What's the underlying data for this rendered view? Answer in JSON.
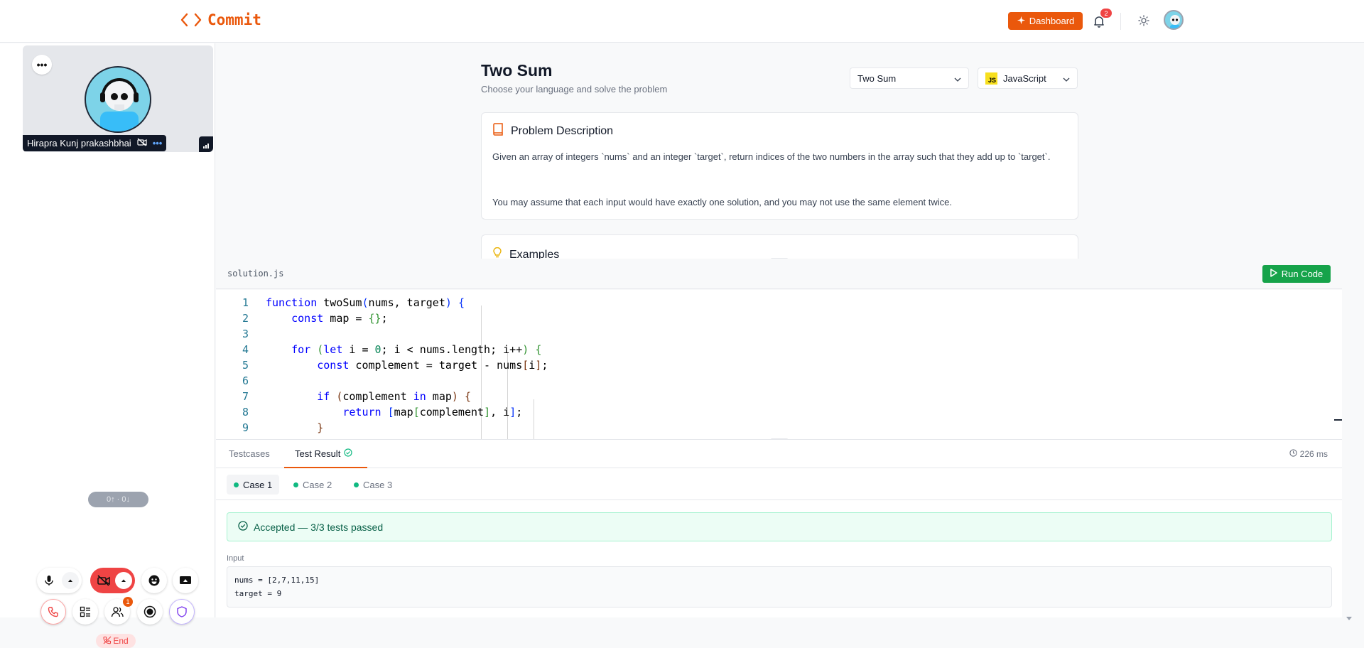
{
  "header": {
    "logo_text": "Commit",
    "dashboard_label": "Dashboard",
    "notification_count": "2",
    "accent": "#ea580c"
  },
  "sidebar": {
    "participant_name": "Hirapra Kunj prakashbhai",
    "network_stats": "0↑ · 0↓",
    "people_count": "1",
    "end_label": "End",
    "icons": [
      "more-icon",
      "mic-icon",
      "chevron-up-icon",
      "camera-off-icon",
      "emoji-icon",
      "screen-share-icon",
      "phone-icon",
      "layout-icon",
      "people-icon",
      "record-icon",
      "shield-icon"
    ]
  },
  "problem": {
    "title": "Two Sum",
    "subtitle": "Choose your language and solve the problem",
    "problem_select": "Two Sum",
    "language_select": "JavaScript",
    "js_badge": "JS",
    "description_heading": "Problem Description",
    "description_p1": "Given an array of integers `nums` and an integer `target`, return indices of the two numbers in the array such that they add up to `target`.",
    "description_p2": "You may assume that each input would have exactly one solution, and you may not use the same element twice.",
    "examples_heading": "Examples"
  },
  "editor": {
    "filename": "solution.js",
    "run_label": "Run Code",
    "line_numbers": [
      "1",
      "2",
      "3",
      "4",
      "5",
      "6",
      "7",
      "8",
      "9"
    ]
  },
  "results": {
    "tab_testcases": "Testcases",
    "tab_result": "Test Result",
    "timing": "226 ms",
    "cases": [
      "Case 1",
      "Case 2",
      "Case 3"
    ],
    "status": "Accepted — 3/3 tests passed",
    "input_label": "Input",
    "input_line1": "nums = [2,7,11,15]",
    "input_line2": "target = 9",
    "success_color": "#10b981"
  }
}
